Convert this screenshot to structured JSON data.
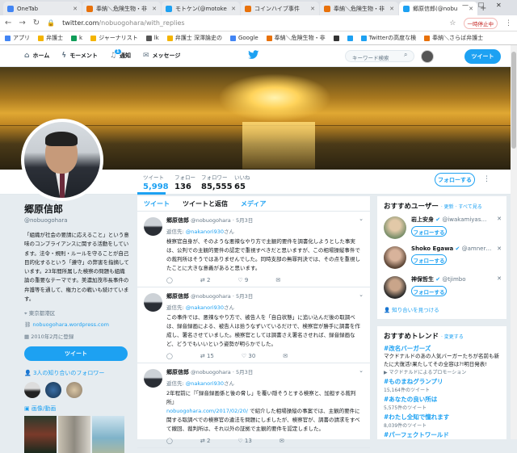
{
  "browser": {
    "tabs": [
      {
        "title": "OneTab",
        "color": "#4285f4"
      },
      {
        "title": "奉納＼危険生物・非",
        "color": "#e8710a"
      },
      {
        "title": "モトケン(@motoke",
        "color": "#1da1f2"
      },
      {
        "title": "コインハイブ事件",
        "color": "#e8710a"
      },
      {
        "title": "奉納＼危険生物・非",
        "color": "#e8710a"
      },
      {
        "title": "郷原信郎(@nobu",
        "color": "#1da1f2",
        "active": true
      }
    ],
    "url_host": "twitter.com",
    "url_path": "/nobuogohara/with_replies",
    "bookmarks": [
      "アプリ",
      "弁護士",
      "k",
      "ジャーナリスト",
      "lk",
      "弁護士 深澤論史の",
      "Google",
      "奉納＼危険生物・非",
      "",
      "",
      "Twitterの高度な検",
      "奉納＼さらば弁護士"
    ],
    "bookmark_colors": [
      "#4285f4",
      "#f4b400",
      "#0f9d58",
      "#f4b400",
      "#555555",
      "#f4b400",
      "#4285f4",
      "#e8710a",
      "#333333",
      "#1da1f2",
      "#1da1f2",
      "#e8710a"
    ],
    "window_label": "一時停止中"
  },
  "twitter_nav": {
    "home": "ホーム",
    "moments": "モーメント",
    "notifications": "通知",
    "notif_count": "1",
    "messages": "メッセージ",
    "search_placeholder": "キーワード検索",
    "tweet_button": "ツイート"
  },
  "profile": {
    "name": "郷原信郎",
    "handle": "@nobuogohara",
    "bio": "「組織が社会の要請に応えること」という意味のコンプライアンスに関する活動をしています。法令・規則・ルールを守ることが自己目的化するという「遵守」の弊害を指摘しています。23年間所属した検察の問題も組織論の重要なテーマです。美濃加茂市長事件の弁護等を通して、権力との戦いも続けています。",
    "location": "東京都港区",
    "website": "nobuogohara.wordpress.com",
    "joined": "2010年2月に登録",
    "tweet_button": "ツイート",
    "followers_you_know": "3人の知り合いのフォロワー",
    "media_label": "画像/動画"
  },
  "stats": [
    {
      "label": "ツイート",
      "value": "5,998"
    },
    {
      "label": "フォロー",
      "value": "136"
    },
    {
      "label": "フォロワー",
      "value": "85,555"
    },
    {
      "label": "いいね",
      "value": "65"
    }
  ],
  "follow_button": "フォローする",
  "timeline": {
    "tabs": [
      "ツイート",
      "ツイートと返信",
      "メディア"
    ],
    "tweets": [
      {
        "name": "郷原信郎",
        "handle": "@nobuogohara",
        "date": "5月3日",
        "reply_prefix": "返信先:",
        "reply_to": "@nakanori930",
        "reply_suffix": "さん",
        "text": "検察官自身が、そのような悪辣なやり方で主観的要件を調書化しようとした事実は、公判での主観的要件の認定で重視すべきだと思いますが、この相場操縦事件での裁判所はそうではありませんでした。同時支部の無罪判決では、その点を重視したことに大きな意義があると思います。",
        "link": "",
        "text2": "",
        "replies": "",
        "retweets": "2",
        "likes": "9"
      },
      {
        "name": "郷原信郎",
        "handle": "@nobuogohara",
        "date": "5月3日",
        "reply_prefix": "返信先:",
        "reply_to": "@nakanori930",
        "reply_suffix": "さん",
        "text": "この事件では、悪辣なやり方で、被告人を「自白状態」に追い込んだ後の取調べは、録音録画による、被告人は拾うなずいているだけで、検察官が勝手に調書を作成し、署名させていました。検察官としては調書さえ署名させれば、録音録画など、どうでもいいという姿勢が明らかでした。",
        "link": "",
        "text2": "",
        "replies": "",
        "retweets": "15",
        "likes": "30"
      },
      {
        "name": "郷原信郎",
        "handle": "@nobuogohara",
        "date": "5月3日",
        "reply_prefix": "返信先:",
        "reply_to": "@nakanori930",
        "reply_suffix": "さん",
        "text": "2年程前に『「録音録画係と後の脅し」を覆い隠そうとする検察と、加担する裁判所』",
        "link": "nobuogohara.com/2017/02/20/",
        "text2": "で紹介した相場操縦の事案では、主観的要件に関する取調べでの検察官の違法を問題にしましたが、検察官が、調書の請求をすべて撤回、裁判所は、それ以外の証拠で主観的要件を認定しました。",
        "replies": "",
        "retweets": "2",
        "likes": "13"
      }
    ]
  },
  "suggestions": {
    "title": "おすすめユーザー",
    "links": "· 更新 · すべて見る",
    "users": [
      {
        "name": "岩上安身",
        "handle": "@iwakamiyas…",
        "color": "#7a8f6a",
        "follow": "フォローする"
      },
      {
        "name": "Shoko Egawa",
        "handle": "@amner…",
        "color": "#8b6d5a",
        "follow": "フォローする"
      },
      {
        "name": "神保哲生",
        "handle": "@tjimbo",
        "color": "#3b3b3b",
        "follow": "フォローする"
      }
    ],
    "find_friends": "知り合いを見つける"
  },
  "trends": {
    "title": "おすすめトレンド",
    "change": "· 変更する",
    "items": [
      {
        "name": "#改名バーガーズ",
        "desc": "マクドナルドのあの人気バーガーたちが名前も新たに大復活!果たしてその全容は?!明日発表!",
        "count": "マクドナルドによるプロモーション"
      },
      {
        "name": "#ものまねグランプリ",
        "desc": "",
        "count": "15,164件のツイート"
      },
      {
        "name": "#あなたの良い所は",
        "desc": "",
        "count": "5,575件のツイート"
      },
      {
        "name": "#わたし全知で憧れます",
        "desc": "",
        "count": "8,039件のツイート"
      },
      {
        "name": "#パーフェクトワールド",
        "desc": "",
        "count": ""
      }
    ]
  }
}
